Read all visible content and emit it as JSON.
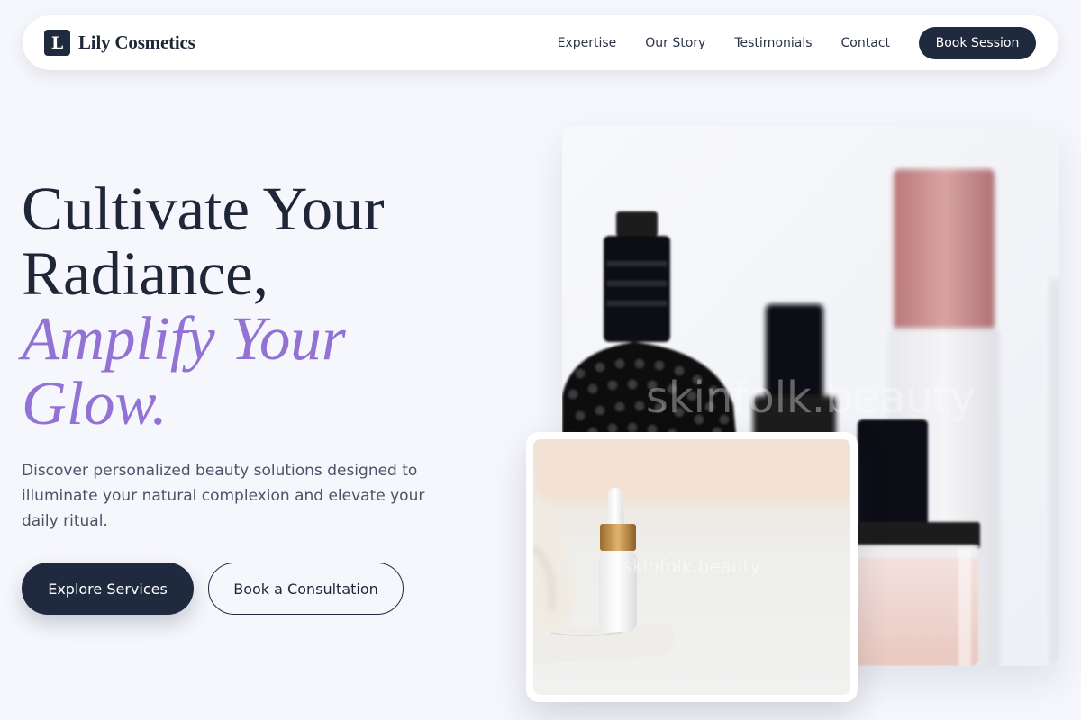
{
  "brand": {
    "mark": "L",
    "name": "Lily Cosmetics"
  },
  "nav": {
    "links": [
      "Expertise",
      "Our Story",
      "Testimonials",
      "Contact"
    ],
    "cta": "Book Session"
  },
  "hero": {
    "headline_line1": "Cultivate Your",
    "headline_line2": "Radiance,",
    "headline_accent1": "Amplify Your",
    "headline_accent2": "Glow.",
    "lede": "Discover personalized beauty solutions designed to illuminate your natural complexion and elevate your daily ritual.",
    "primary_button": "Explore Services",
    "secondary_button": "Book a Consultation"
  },
  "images": {
    "main_watermark": "skinfolk.beauty",
    "small_watermark": "skinfolk.beauty"
  },
  "colors": {
    "navy": "#1f2a3e",
    "accent": "#9272d4",
    "background": "#f6f7fc"
  }
}
